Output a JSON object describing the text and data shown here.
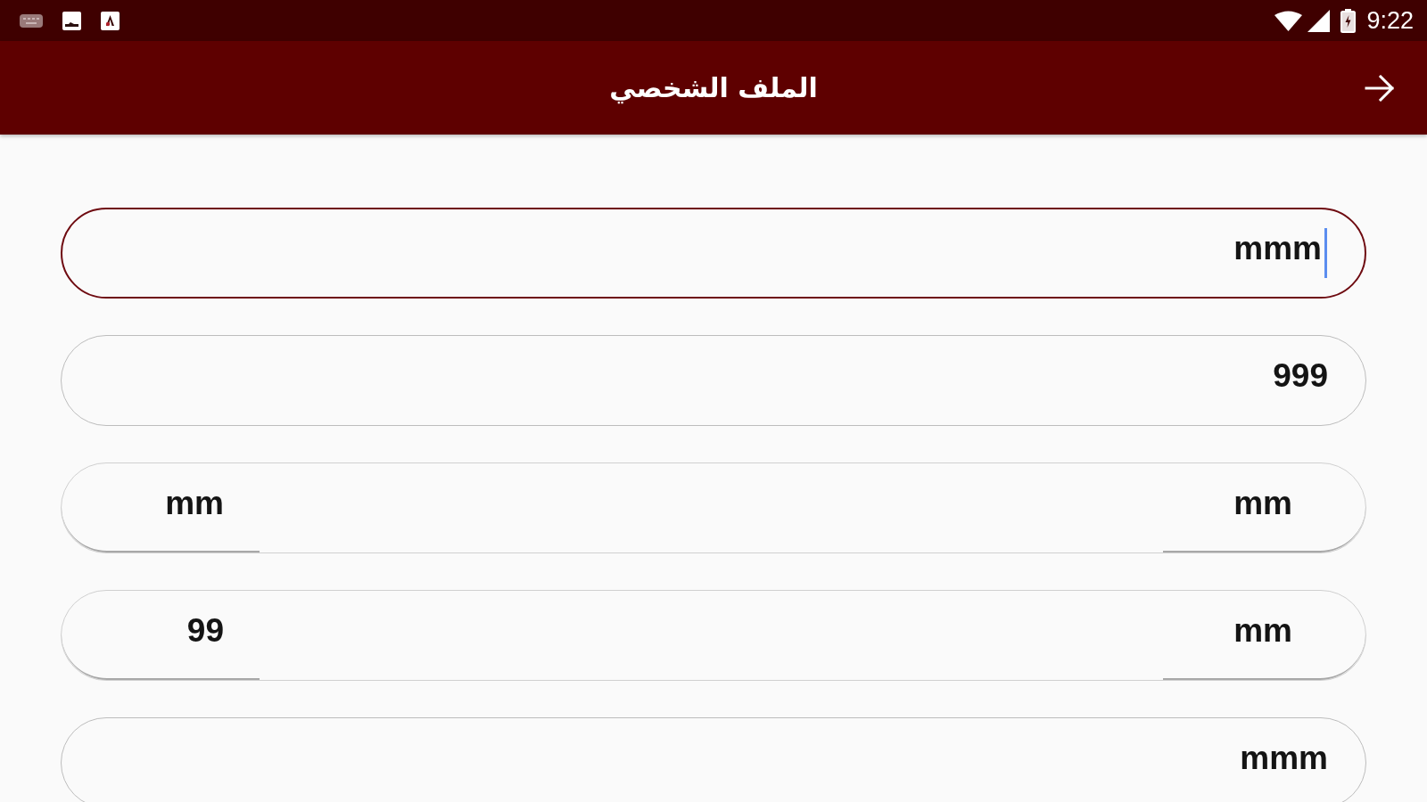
{
  "status_bar": {
    "time": "9:22"
  },
  "app_bar": {
    "title": "الملف الشخصي"
  },
  "fields": [
    {
      "kind": "single",
      "value": "mmm",
      "focused": true
    },
    {
      "kind": "single",
      "value": "999",
      "focused": false
    },
    {
      "kind": "pair",
      "values": [
        "mm",
        "mm"
      ],
      "focused": false
    },
    {
      "kind": "pair",
      "values": [
        "99",
        "mm"
      ],
      "focused": false
    },
    {
      "kind": "single",
      "value": "mmm",
      "focused": false
    }
  ]
}
